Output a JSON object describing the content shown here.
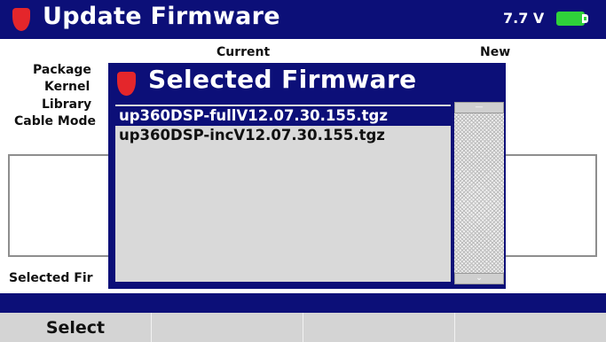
{
  "header": {
    "title": "Update Firmware",
    "voltage": "7.7 V",
    "battery_icon": "battery-icon",
    "logo_icon": "shield-logo-icon"
  },
  "columns": {
    "current": "Current",
    "new": "New"
  },
  "rows": {
    "package": "Package",
    "kernel": "Kernel",
    "library": "Library",
    "cable_modem": "Cable Mode"
  },
  "selected_label": "Selected Fir",
  "dialog": {
    "title": "Selected Firmware",
    "items": [
      "up360DSP-fullV12.07.30.155.tgz",
      "up360DSP-incV12.07.30.155.tgz"
    ],
    "selected_index": 0
  },
  "softkeys": [
    "Select",
    "",
    "",
    ""
  ],
  "colors": {
    "header_bg": "#0c0f78",
    "shield": "#e4262b",
    "battery": "#2fd23a",
    "softkey_bg": "#d4d4d4"
  }
}
